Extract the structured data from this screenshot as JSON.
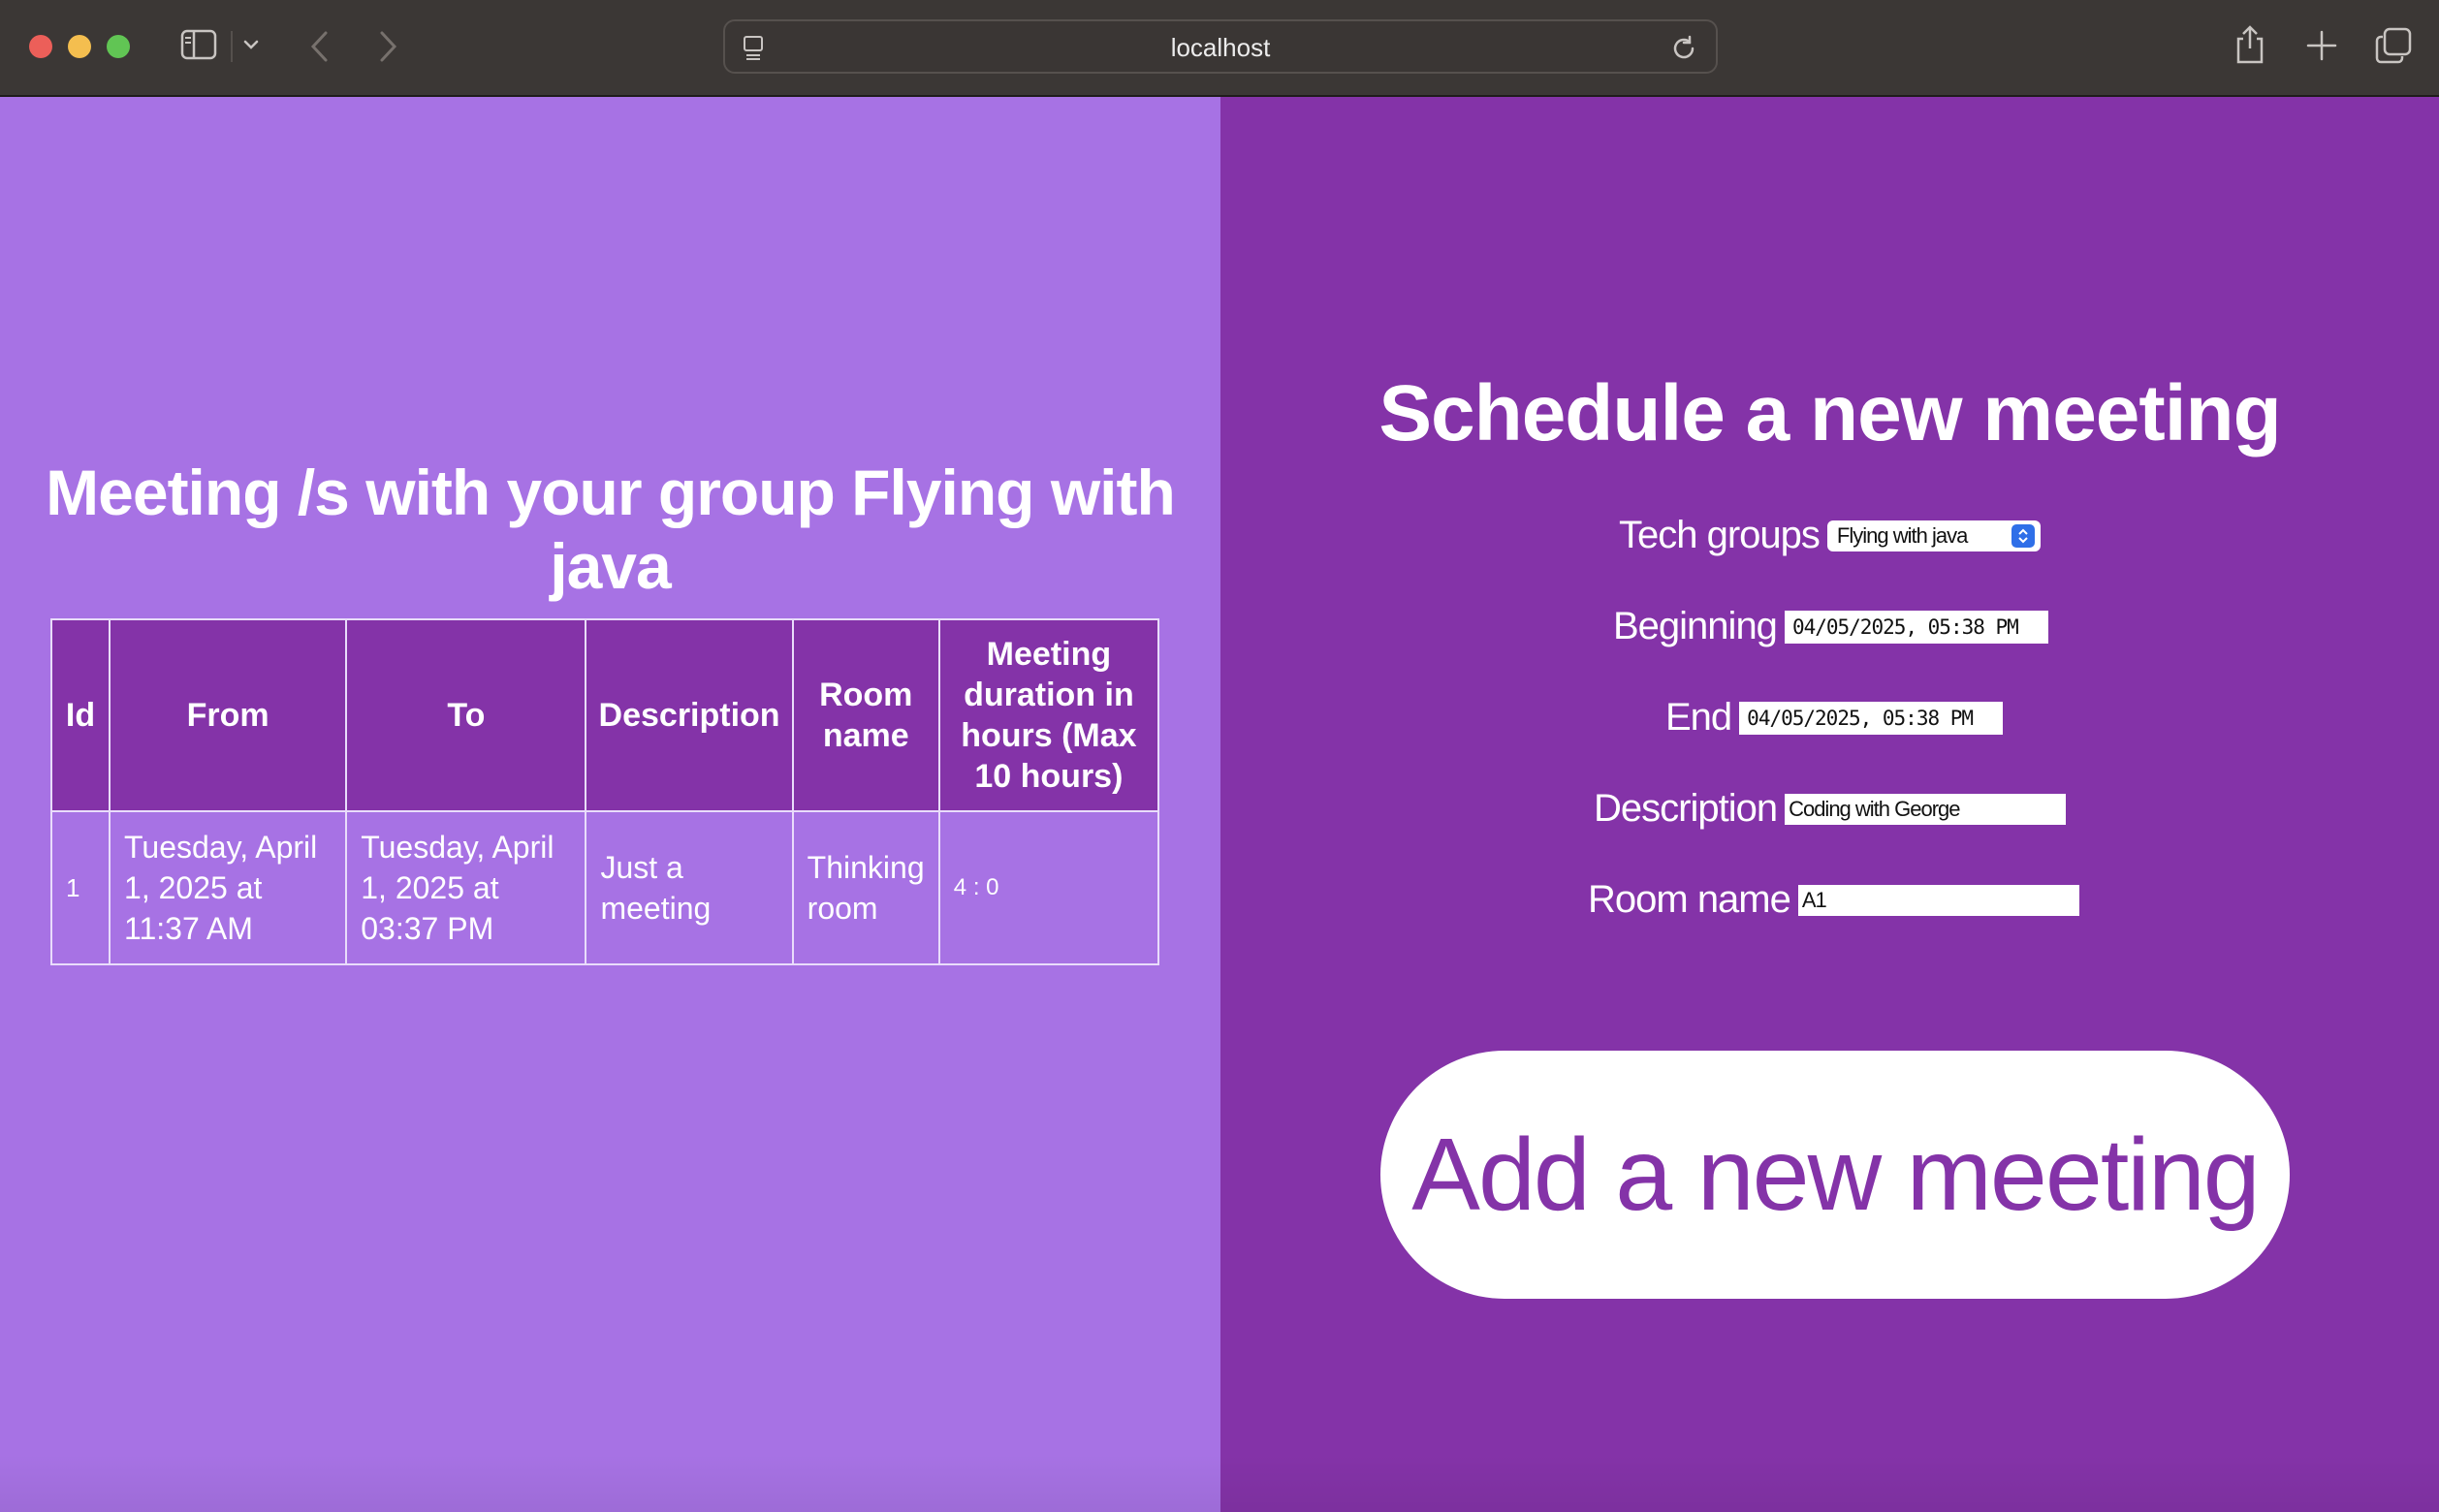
{
  "browser": {
    "url": "localhost",
    "icons": [
      "sidebar-icon",
      "chevron-down-icon",
      "back-arrow-icon",
      "forward-arrow-icon",
      "page-icon",
      "reload-icon",
      "share-icon",
      "plus-icon",
      "tabs-icon"
    ]
  },
  "colors": {
    "left_bg": "#a772e4",
    "right_bg": "#8433a8",
    "header_cell": "#8433a8",
    "button_text": "#8433a8"
  },
  "left": {
    "title": "Meeting /s with your group Flying with java",
    "table": {
      "headers": {
        "id": "Id",
        "from": "From",
        "to": "To",
        "description": "Description",
        "room": "Room name",
        "duration": "Meeting duration in hours (Max 10 hours)"
      },
      "rows": [
        {
          "id": "1",
          "from": "Tuesday, April 1, 2025 at 11:37 AM",
          "to": "Tuesday, April 1, 2025 at 03:37 PM",
          "description": "Just a meeting",
          "room": "Thinking room",
          "duration": "4 : 0"
        }
      ]
    }
  },
  "right": {
    "title": "Schedule a new meeting",
    "tech_groups": {
      "label": "Tech groups",
      "selected": "Flying with java"
    },
    "beginning": {
      "label": "Beginning",
      "value": "04/05/2025, 05:38 PM"
    },
    "end": {
      "label": "End",
      "value": "04/05/2025, 05:38 PM"
    },
    "description": {
      "label": "Description",
      "value": "Coding with George"
    },
    "room_name": {
      "label": "Room name",
      "value": "A1"
    },
    "submit_label": "Add a new meeting"
  }
}
